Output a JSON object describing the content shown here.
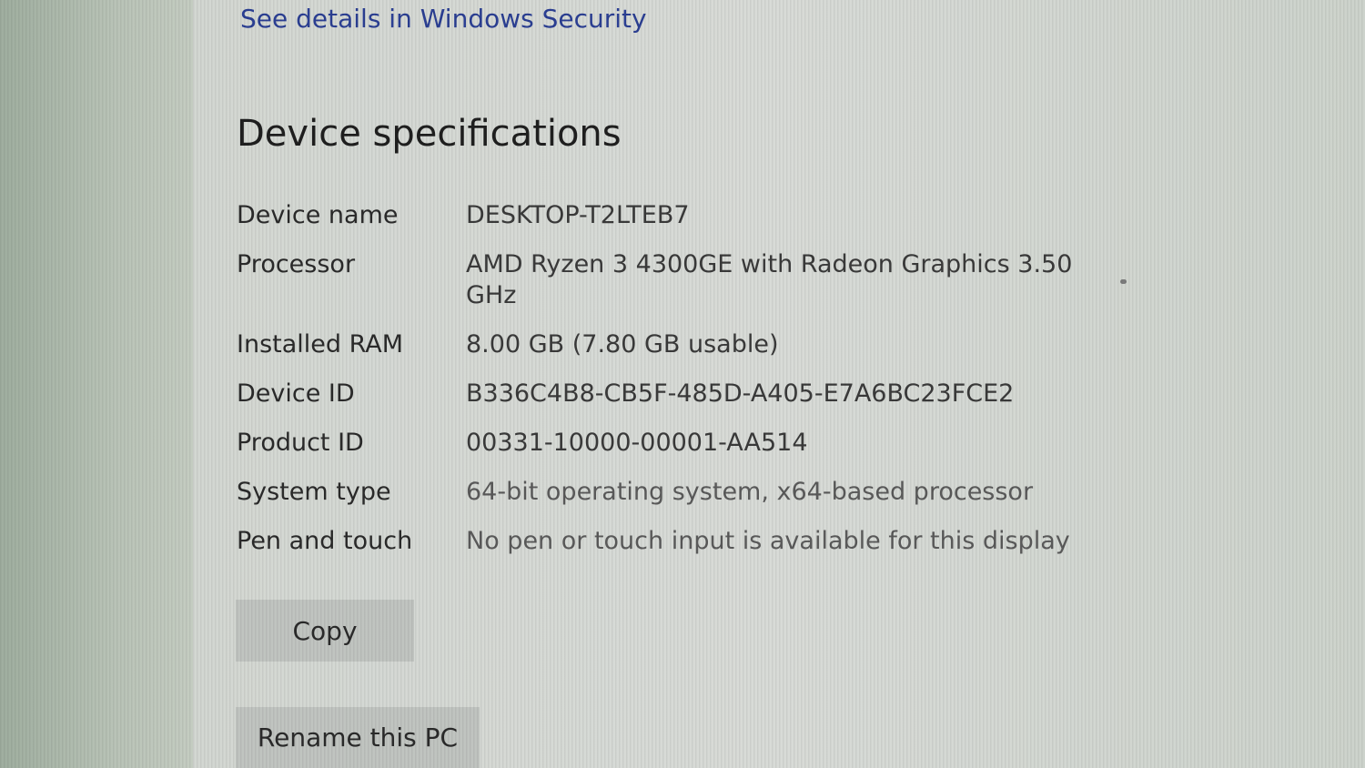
{
  "security": {
    "link_label": "See details in Windows Security"
  },
  "device_specs": {
    "title": "Device specifications",
    "rows": [
      {
        "label": "Device name",
        "value": "DESKTOP-T2LTEB7"
      },
      {
        "label": "Processor",
        "value": "AMD Ryzen 3 4300GE with Radeon Graphics   3.50 GHz"
      },
      {
        "label": "Installed RAM",
        "value": "8.00 GB (7.80 GB usable)"
      },
      {
        "label": "Device ID",
        "value": "B336C4B8-CB5F-485D-A405-E7A6BC23FCE2"
      },
      {
        "label": "Product ID",
        "value": "00331-10000-00001-AA514"
      },
      {
        "label": "System type",
        "value": "64-bit operating system, x64-based processor"
      },
      {
        "label": "Pen and touch",
        "value": "No pen or touch input is available for this display"
      }
    ]
  },
  "buttons": {
    "copy_label": "Copy",
    "rename_label": "Rename this PC"
  }
}
